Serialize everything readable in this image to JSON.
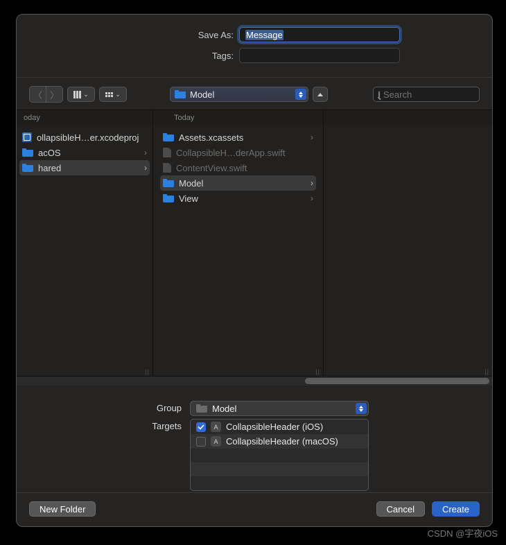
{
  "form": {
    "saveAsLabel": "Save As:",
    "saveAsValue": "Message",
    "tagsLabel": "Tags:",
    "tagsValue": ""
  },
  "toolbar": {
    "path": "Model",
    "searchPlaceholder": "Search"
  },
  "columns": {
    "left": {
      "header": "oday",
      "items": [
        {
          "name": "ollapsibleH…er.xcodeproj",
          "type": "xcodeproj",
          "chevron": false,
          "enabled": true
        },
        {
          "name": "acOS",
          "type": "folder",
          "chevron": true,
          "enabled": true
        },
        {
          "name": "hared",
          "type": "folder",
          "chevron": true,
          "enabled": true,
          "selected": true
        }
      ]
    },
    "mid": {
      "header": "Today",
      "items": [
        {
          "name": "Assets.xcassets",
          "type": "folder",
          "chevron": true,
          "enabled": true
        },
        {
          "name": "CollapsibleH…derApp.swift",
          "type": "doc",
          "chevron": false,
          "enabled": false
        },
        {
          "name": "ContentView.swift",
          "type": "doc",
          "chevron": false,
          "enabled": false
        },
        {
          "name": "Model",
          "type": "folder",
          "chevron": true,
          "enabled": true,
          "selected": true
        },
        {
          "name": "View",
          "type": "folder",
          "chevron": true,
          "enabled": true
        }
      ]
    }
  },
  "group": {
    "label": "Group",
    "value": "Model"
  },
  "targets": {
    "label": "Targets",
    "items": [
      {
        "name": "CollapsibleHeader (iOS)",
        "checked": true
      },
      {
        "name": "CollapsibleHeader (macOS)",
        "checked": false
      }
    ]
  },
  "buttons": {
    "newFolder": "New Folder",
    "cancel": "Cancel",
    "create": "Create"
  },
  "watermark": "CSDN @宇夜iOS"
}
